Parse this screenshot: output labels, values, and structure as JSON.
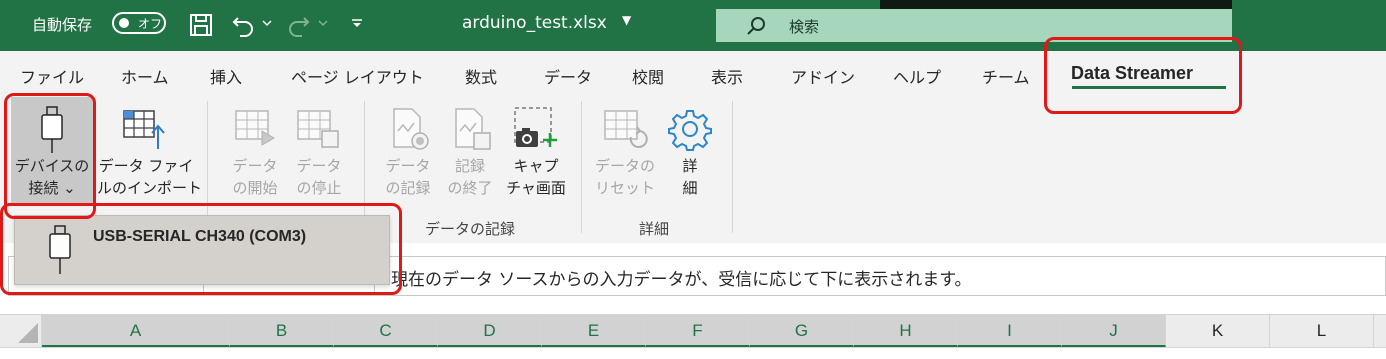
{
  "titlebar": {
    "autosave_label": "自動保存",
    "autosave_state": "オフ",
    "filename": "arduino_test.xlsx",
    "search_placeholder": "検索",
    "color": "#217346"
  },
  "tabs": [
    {
      "label": "ファイル"
    },
    {
      "label": "ホーム"
    },
    {
      "label": "挿入"
    },
    {
      "label": "ページ レイアウト"
    },
    {
      "label": "数式"
    },
    {
      "label": "データ"
    },
    {
      "label": "校閲"
    },
    {
      "label": "表示"
    },
    {
      "label": "アドイン"
    },
    {
      "label": "ヘルプ"
    },
    {
      "label": "チーム"
    },
    {
      "label": "Data Streamer",
      "selected": true
    }
  ],
  "ribbon": {
    "connect_device": {
      "line1": "デバイスの",
      "line2": "接続 ⌄"
    },
    "import_file": {
      "line1": "データ ファイ",
      "line2": "ルのインポート"
    },
    "start_data": {
      "line1": "データ",
      "line2": "の開始"
    },
    "stop_data": {
      "line1": "データ",
      "line2": "の停止"
    },
    "record_data": {
      "line1": "データ",
      "line2": "の記録"
    },
    "stop_record": {
      "line1": "記録",
      "line2": "の終了"
    },
    "capture": {
      "line1": "キャプ",
      "line2": "チャ画面"
    },
    "reset_data": {
      "line1": "データの",
      "line2": "リセット"
    },
    "details": {
      "line1": "詳",
      "line2": "細"
    },
    "group_record": "データの記録",
    "group_details": "詳細"
  },
  "dropdown": {
    "device": "USB-SERIAL CH340 (COM3)"
  },
  "formula_bar": {
    "text": "現在のデータ ソースからの入力データが、受信に応じて下に表示されます。"
  },
  "columns": [
    "A",
    "B",
    "C",
    "D",
    "E",
    "F",
    "G",
    "H",
    "I",
    "J",
    "K",
    "L"
  ],
  "highlight_color": "#e01818"
}
